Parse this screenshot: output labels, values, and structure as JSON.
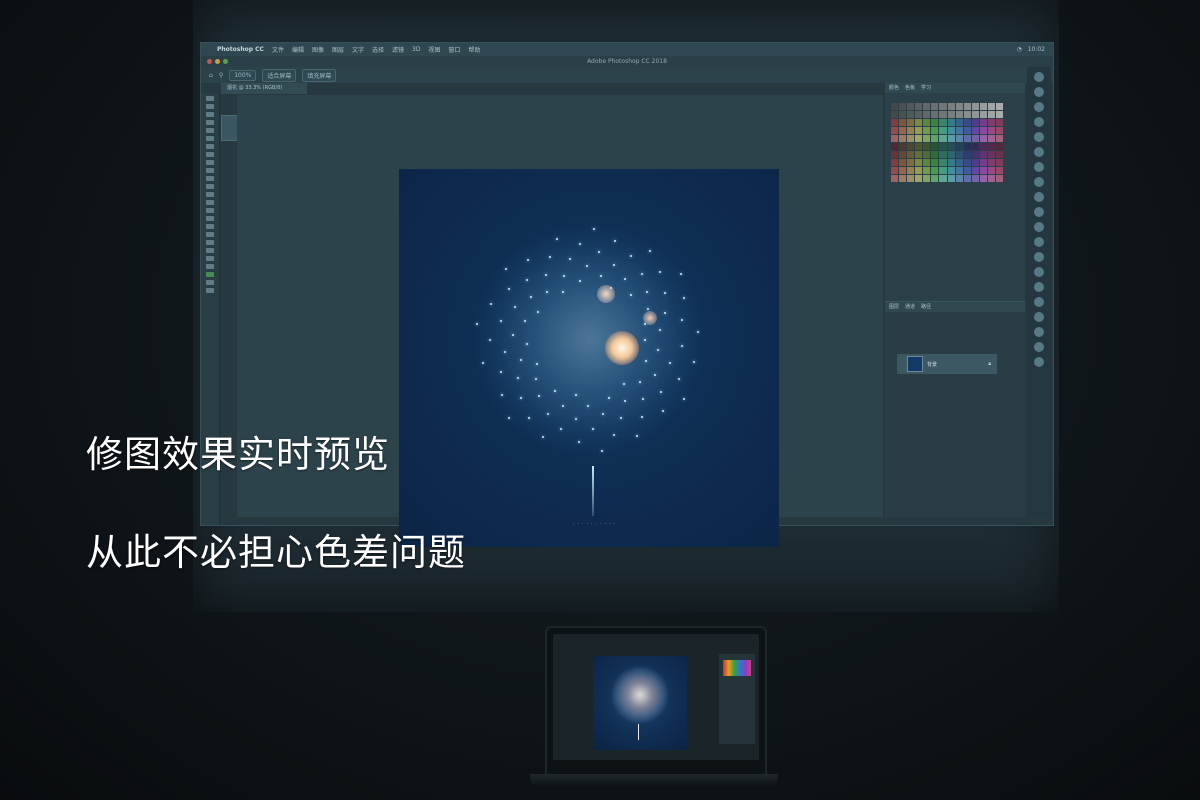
{
  "ps": {
    "app_name": "Photoshop CC",
    "window_title": "Adobe Photoshop CC 2018",
    "menu": [
      "文件",
      "编辑",
      "图像",
      "图层",
      "文字",
      "选择",
      "滤镜",
      "3D",
      "视图",
      "窗口",
      "帮助"
    ],
    "status_time": "10:02",
    "options": {
      "btn1": "100%",
      "btn2": "适合屏幕",
      "btn3": "填充屏幕"
    },
    "doc_tab": "烟花 @ 33.3% (RGB/8)",
    "panel_tabs": [
      "颜色",
      "色板",
      "学习"
    ],
    "layer_tabs": [
      "图层",
      "通道",
      "路径"
    ],
    "layer_name": "背景"
  },
  "caption": {
    "line1": "修图效果实时预览",
    "line2": "从此不必担心色差问题"
  }
}
